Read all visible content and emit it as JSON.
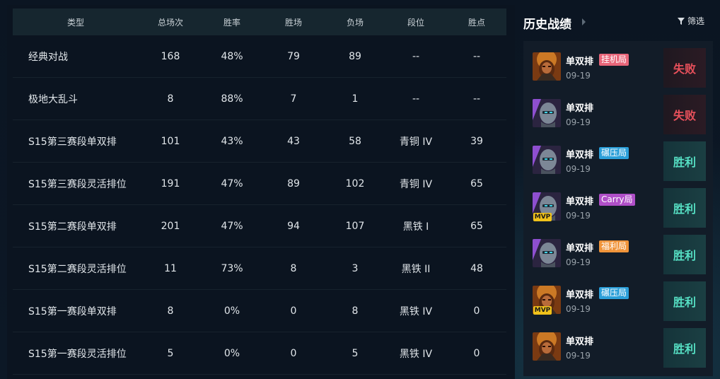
{
  "table": {
    "headers": [
      "类型",
      "总场次",
      "胜率",
      "胜场",
      "负场",
      "段位",
      "胜点"
    ],
    "rows": [
      [
        "经典对战",
        "168",
        "48%",
        "79",
        "89",
        "--",
        "--"
      ],
      [
        "极地大乱斗",
        "8",
        "88%",
        "7",
        "1",
        "--",
        "--"
      ],
      [
        "S15第三赛段单双排",
        "101",
        "43%",
        "43",
        "58",
        "青铜 IV",
        "39"
      ],
      [
        "S15第三赛段灵活排位",
        "191",
        "47%",
        "89",
        "102",
        "青铜 IV",
        "65"
      ],
      [
        "S15第二赛段单双排",
        "201",
        "47%",
        "94",
        "107",
        "黑铁 I",
        "65"
      ],
      [
        "S15第二赛段灵活排位",
        "11",
        "73%",
        "8",
        "3",
        "黑铁 II",
        "48"
      ],
      [
        "S15第一赛段单双排",
        "8",
        "0%",
        "0",
        "8",
        "黑铁 IV",
        "0"
      ],
      [
        "S15第一赛段灵活排位",
        "5",
        "0%",
        "0",
        "5",
        "黑铁 IV",
        "0"
      ]
    ]
  },
  "history": {
    "title": "历史战绩",
    "filter_label": "筛选",
    "matches": [
      {
        "queue": "单双排",
        "tag": "挂机局",
        "tag_color": "#e8667a",
        "date": "09-19",
        "result": "失败",
        "outcome": "loss",
        "champion": "warrior",
        "mvp": false
      },
      {
        "queue": "单双排",
        "tag": "",
        "tag_color": "",
        "date": "09-19",
        "result": "失败",
        "outcome": "loss",
        "champion": "robot",
        "mvp": false
      },
      {
        "queue": "单双排",
        "tag": "碾压局",
        "tag_color": "#2b9fd9",
        "date": "09-19",
        "result": "胜利",
        "outcome": "win",
        "champion": "robot",
        "mvp": false
      },
      {
        "queue": "单双排",
        "tag": "Carry局",
        "tag_color": "#b04fc8",
        "date": "09-19",
        "result": "胜利",
        "outcome": "win",
        "champion": "robot",
        "mvp": true
      },
      {
        "queue": "单双排",
        "tag": "福利局",
        "tag_color": "#f0943a",
        "date": "09-19",
        "result": "胜利",
        "outcome": "win",
        "champion": "robot",
        "mvp": false
      },
      {
        "queue": "单双排",
        "tag": "碾压局",
        "tag_color": "#2b9fd9",
        "date": "09-19",
        "result": "胜利",
        "outcome": "win",
        "champion": "warrior",
        "mvp": true
      },
      {
        "queue": "单双排",
        "tag": "",
        "tag_color": "",
        "date": "09-19",
        "result": "胜利",
        "outcome": "win",
        "champion": "warrior",
        "mvp": false
      }
    ],
    "mvp_label": "MVP"
  }
}
